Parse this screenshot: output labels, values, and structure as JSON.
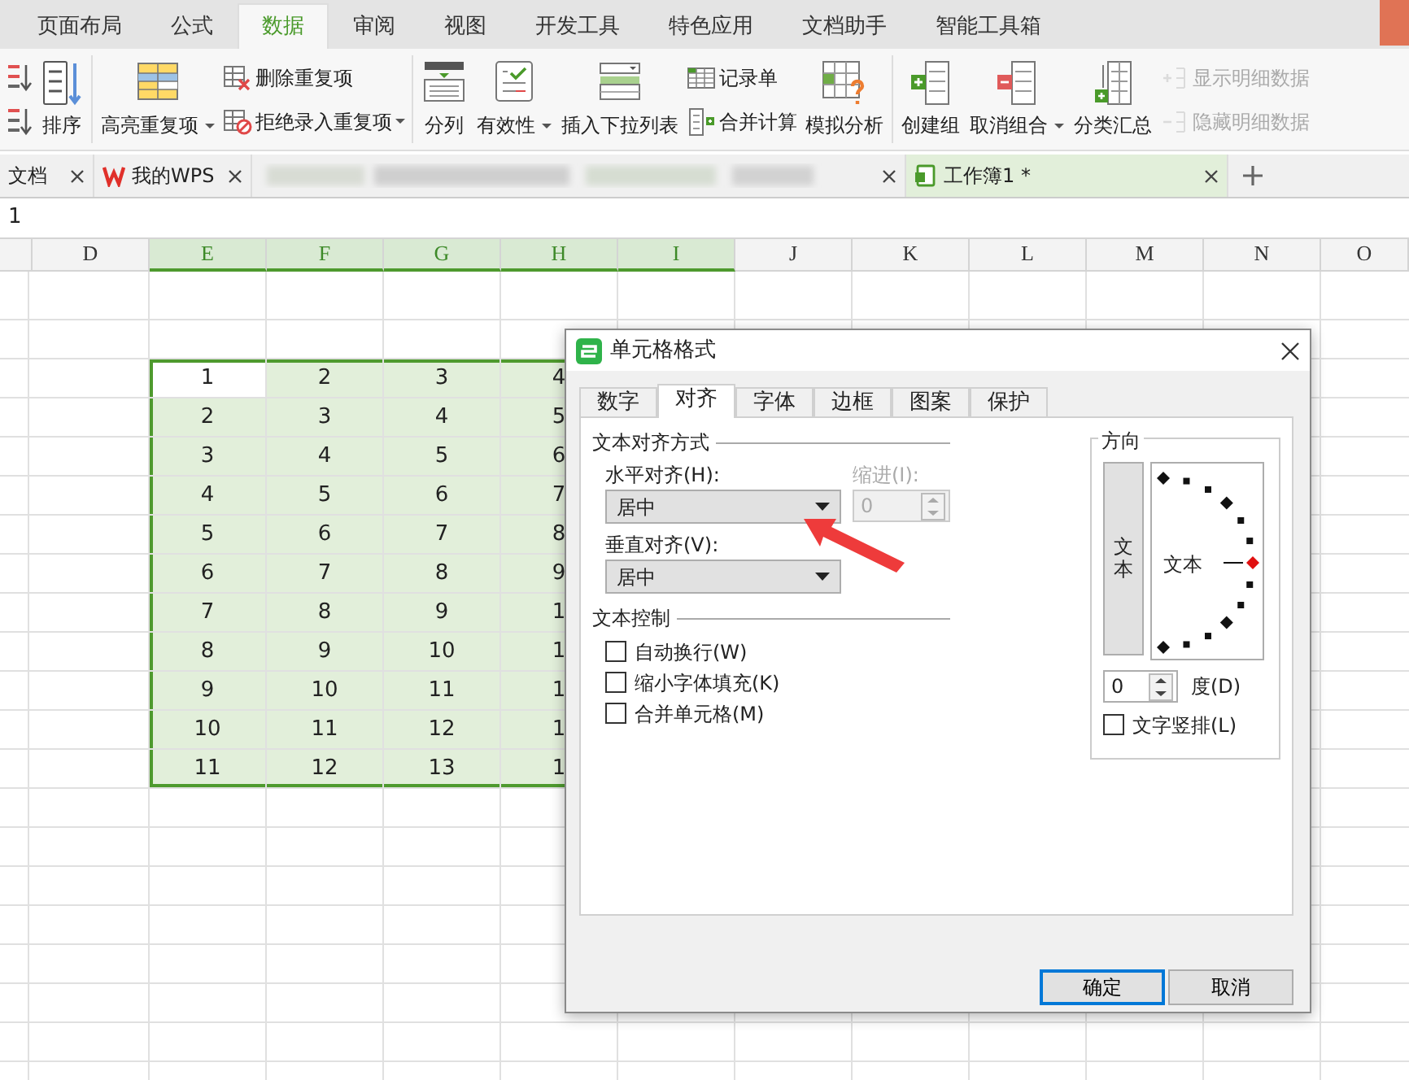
{
  "ribbon_tabs": [
    {
      "label": "页面布局",
      "selected": false
    },
    {
      "label": "公式",
      "selected": false
    },
    {
      "label": "数据",
      "selected": true
    },
    {
      "label": "审阅",
      "selected": false
    },
    {
      "label": "视图",
      "selected": false
    },
    {
      "label": "开发工具",
      "selected": false
    },
    {
      "label": "特色应用",
      "selected": false
    },
    {
      "label": "文档助手",
      "selected": false
    },
    {
      "label": "智能工具箱",
      "selected": false
    }
  ],
  "ribbon_groups": [
    {
      "columns": [
        [
          {
            "kind": "small",
            "dropdown": false,
            "disabled": false
          },
          {
            "kind": "small",
            "dropdown": false,
            "disabled": false
          }
        ],
        [
          {
            "kind": "large",
            "label": "排序",
            "dropdown": false,
            "disabled": false
          }
        ]
      ]
    },
    {
      "columns": [
        [
          {
            "kind": "large",
            "label": "高亮重复项",
            "dropdown": true,
            "disabled": false
          }
        ],
        [
          {
            "kind": "small",
            "label": "删除重复项",
            "dropdown": false,
            "disabled": false
          },
          {
            "kind": "small",
            "label": "拒绝录入重复项",
            "dropdown": true,
            "disabled": false
          }
        ]
      ]
    },
    {
      "columns": [
        [
          {
            "kind": "large",
            "label": "分列",
            "dropdown": false,
            "disabled": false
          }
        ],
        [
          {
            "kind": "large",
            "label": "有效性",
            "dropdown": true,
            "disabled": false
          }
        ],
        [
          {
            "kind": "large",
            "label": "插入下拉列表",
            "dropdown": false,
            "disabled": false
          }
        ],
        [
          {
            "kind": "small",
            "label": "记录单",
            "dropdown": false,
            "disabled": false
          },
          {
            "kind": "small",
            "label": "合并计算",
            "dropdown": false,
            "disabled": false
          }
        ],
        [
          {
            "kind": "large",
            "label": "模拟分析",
            "dropdown": false,
            "disabled": false
          }
        ]
      ]
    },
    {
      "columns": [
        [
          {
            "kind": "large",
            "label": "创建组",
            "dropdown": false,
            "disabled": false
          }
        ],
        [
          {
            "kind": "large",
            "label": "取消组合",
            "dropdown": true,
            "disabled": false
          }
        ],
        [
          {
            "kind": "large",
            "label": "分类汇总",
            "dropdown": false,
            "disabled": false
          }
        ],
        [
          {
            "kind": "small",
            "label": "显示明细数据",
            "dropdown": false,
            "disabled": true
          },
          {
            "kind": "small",
            "label": "隐藏明细数据",
            "dropdown": false,
            "disabled": true
          }
        ]
      ]
    }
  ],
  "doc_tabs": [
    {
      "kind": "plain",
      "label": "文档",
      "selected": false
    },
    {
      "kind": "app",
      "label": "我的WPS",
      "selected": false
    },
    {
      "kind": "blurred",
      "selected": false
    },
    {
      "kind": "workbook",
      "label": "工作簿1 *",
      "selected": true
    }
  ],
  "formula_bar": {
    "value": "1"
  },
  "sheet": {
    "columns": [
      {
        "label": "D",
        "selected": false
      },
      {
        "label": "E",
        "selected": true
      },
      {
        "label": "F",
        "selected": true
      },
      {
        "label": "G",
        "selected": true
      },
      {
        "label": "H",
        "selected": true
      },
      {
        "label": "I",
        "selected": true
      },
      {
        "label": "J",
        "selected": false
      },
      {
        "label": "K",
        "selected": false
      },
      {
        "label": "L",
        "selected": false
      },
      {
        "label": "M",
        "selected": false
      },
      {
        "label": "N",
        "selected": false
      },
      {
        "label": "O",
        "selected": false
      }
    ],
    "data_rows": [
      [
        {
          "text": "1",
          "active": true
        },
        {
          "text": "2",
          "active": false
        },
        {
          "text": "3",
          "active": false
        },
        {
          "text": "4",
          "active": false
        }
      ],
      [
        {
          "text": "2",
          "active": false
        },
        {
          "text": "3",
          "active": false
        },
        {
          "text": "4",
          "active": false
        },
        {
          "text": "5",
          "active": false
        }
      ],
      [
        {
          "text": "3",
          "active": false
        },
        {
          "text": "4",
          "active": false
        },
        {
          "text": "5",
          "active": false
        },
        {
          "text": "6",
          "active": false
        }
      ],
      [
        {
          "text": "4",
          "active": false
        },
        {
          "text": "5",
          "active": false
        },
        {
          "text": "6",
          "active": false
        },
        {
          "text": "7",
          "active": false
        }
      ],
      [
        {
          "text": "5",
          "active": false
        },
        {
          "text": "6",
          "active": false
        },
        {
          "text": "7",
          "active": false
        },
        {
          "text": "8",
          "active": false
        }
      ],
      [
        {
          "text": "6",
          "active": false
        },
        {
          "text": "7",
          "active": false
        },
        {
          "text": "8",
          "active": false
        },
        {
          "text": "9",
          "active": false
        }
      ],
      [
        {
          "text": "7",
          "active": false
        },
        {
          "text": "8",
          "active": false
        },
        {
          "text": "9",
          "active": false
        },
        {
          "text": "1",
          "active": false
        }
      ],
      [
        {
          "text": "8",
          "active": false
        },
        {
          "text": "9",
          "active": false
        },
        {
          "text": "10",
          "active": false
        },
        {
          "text": "1",
          "active": false
        }
      ],
      [
        {
          "text": "9",
          "active": false
        },
        {
          "text": "10",
          "active": false
        },
        {
          "text": "11",
          "active": false
        },
        {
          "text": "1",
          "active": false
        }
      ],
      [
        {
          "text": "10",
          "active": false
        },
        {
          "text": "11",
          "active": false
        },
        {
          "text": "12",
          "active": false
        },
        {
          "text": "1",
          "active": false
        }
      ],
      [
        {
          "text": "11",
          "active": false
        },
        {
          "text": "12",
          "active": false
        },
        {
          "text": "13",
          "active": false
        },
        {
          "text": "1",
          "active": false
        }
      ]
    ]
  },
  "dialog": {
    "title": "单元格格式",
    "tabs": [
      {
        "label": "数字",
        "selected": false
      },
      {
        "label": "对齐",
        "selected": true
      },
      {
        "label": "字体",
        "selected": false
      },
      {
        "label": "边框",
        "selected": false
      },
      {
        "label": "图案",
        "selected": false
      },
      {
        "label": "保护",
        "selected": false
      }
    ],
    "alignment_section": {
      "title": "文本对齐方式",
      "horizontal": {
        "label": "水平对齐(H):",
        "value": "居中"
      },
      "indent": {
        "label": "缩进(I):",
        "value": "0",
        "disabled": true
      },
      "vertical": {
        "label": "垂直对齐(V):",
        "value": "居中"
      }
    },
    "control_section": {
      "title": "文本控制",
      "options": [
        {
          "label": "自动换行(W)",
          "checked": false
        },
        {
          "label": "缩小字体填充(K)",
          "checked": false
        },
        {
          "label": "合并单元格(M)",
          "checked": false
        }
      ]
    },
    "orientation": {
      "title": "方向",
      "vertical_text_button": "文本",
      "dial_text": "文本",
      "degrees": {
        "value": "0",
        "label": "度(D)"
      },
      "vertical_option": {
        "label": "文字竖排(L)",
        "checked": false
      }
    },
    "buttons": [
      {
        "label": "确定",
        "focused": true
      },
      {
        "label": "取消",
        "focused": false
      }
    ]
  }
}
